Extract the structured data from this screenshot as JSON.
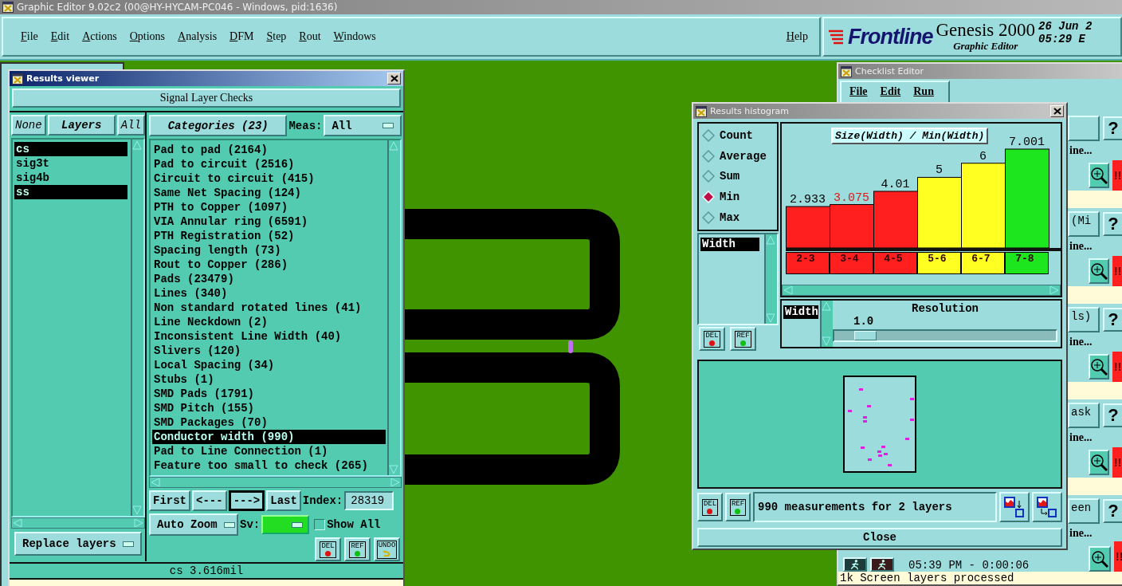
{
  "window": {
    "title": "Graphic Editor 9.02c2 (00@HY-HYCAM-PC046 - Windows, pid:1636)"
  },
  "menu": [
    "File",
    "Edit",
    "Actions",
    "Options",
    "Analysis",
    "DFM",
    "Step",
    "Rout",
    "Windows"
  ],
  "help": "Help",
  "brand": {
    "logo": "Frontline",
    "product": "Genesis 2000",
    "subtitle": "Graphic Editor",
    "date": "26 Jun 2",
    "time": "05:29 E"
  },
  "results_viewer": {
    "title": "Results viewer",
    "header": "Signal Layer Checks",
    "layer_buttons": [
      {
        "label": "None",
        "kind": "select"
      },
      {
        "label": "Layers",
        "kind": "header"
      },
      {
        "label": "All",
        "kind": "select"
      }
    ],
    "layers": [
      {
        "name": "cs",
        "selected": true
      },
      {
        "name": "sig3t",
        "selected": false
      },
      {
        "name": "sig4b",
        "selected": false
      },
      {
        "name": "ss",
        "selected": true
      }
    ],
    "replace": "Replace layers",
    "categories_button": "Categories (23)",
    "meas_label": "Meas:",
    "meas_value": "All",
    "categories": [
      {
        "label": "Pad to pad (2164)",
        "selected": false
      },
      {
        "label": "Pad to circuit (2516)",
        "selected": false
      },
      {
        "label": "Circuit to circuit (415)",
        "selected": false
      },
      {
        "label": "Same Net Spacing (124)",
        "selected": false
      },
      {
        "label": "PTH to Copper (1097)",
        "selected": false
      },
      {
        "label": "VIA Annular ring (6591)",
        "selected": false
      },
      {
        "label": "PTH Registration (52)",
        "selected": false
      },
      {
        "label": "Spacing length (73)",
        "selected": false
      },
      {
        "label": "Rout to Copper (286)",
        "selected": false
      },
      {
        "label": "Pads (23479)",
        "selected": false
      },
      {
        "label": "Lines (340)",
        "selected": false
      },
      {
        "label": "Non standard rotated lines (41)",
        "selected": false
      },
      {
        "label": "Line Neckdown (2)",
        "selected": false
      },
      {
        "label": "Inconsistent Line Width (40)",
        "selected": false
      },
      {
        "label": "Slivers (120)",
        "selected": false
      },
      {
        "label": "Local Spacing (34)",
        "selected": false
      },
      {
        "label": "Stubs (1)",
        "selected": false
      },
      {
        "label": "SMD Pads (1791)",
        "selected": false
      },
      {
        "label": "SMD Pitch (155)",
        "selected": false
      },
      {
        "label": "SMD Packages (70)",
        "selected": false
      },
      {
        "label": "Conductor width (990)",
        "selected": true
      },
      {
        "label": "Pad to Line Connection (1)",
        "selected": false
      },
      {
        "label": "Feature too small to check (265)",
        "selected": false
      }
    ],
    "nav": [
      {
        "label": "First",
        "focused": false
      },
      {
        "label": "<---",
        "focused": false
      },
      {
        "label": "--->",
        "focused": true
      },
      {
        "label": "Last",
        "focused": false
      }
    ],
    "index_label": "Index:",
    "index_value": "28319",
    "auto_zoom": "Auto Zoom",
    "sv_label": "Sv:",
    "show_all": {
      "label": "Show All",
      "checked": false
    },
    "tools": [
      {
        "kind": "del",
        "label": "DEL"
      },
      {
        "kind": "ref",
        "label": "REF"
      },
      {
        "kind": "undo",
        "label": "UNDO"
      }
    ],
    "status": "cs 3.616mil"
  },
  "histogram": {
    "title": "Results histogram",
    "modes": [
      {
        "label": "Count",
        "selected": false
      },
      {
        "label": "Average",
        "selected": false
      },
      {
        "label": "Sum",
        "selected": false
      },
      {
        "label": "Min",
        "selected": true
      },
      {
        "label": "Max",
        "selected": false
      }
    ],
    "fields": [
      {
        "label": "Width",
        "selected": true
      }
    ],
    "tools": [
      {
        "kind": "del",
        "label": "DEL"
      },
      {
        "kind": "ref",
        "label": "REF"
      }
    ],
    "map_tools": [
      {
        "kind": "del",
        "label": "DEL"
      },
      {
        "kind": "ref",
        "label": "REF"
      }
    ],
    "chart_data": {
      "type": "bar",
      "title": "Size(Width) / Min(Width)",
      "categories": [
        "2-3",
        "3-4",
        "4-5",
        "5-6",
        "6-7",
        "7-8"
      ],
      "values": [
        2.933,
        3.075,
        4.01,
        5,
        6,
        7.001
      ],
      "data_labels": true
    },
    "bins": [
      {
        "color": "#ff1f1f",
        "selected": false
      },
      {
        "color": "#ff1f1f",
        "selected": true
      },
      {
        "color": "#ff1f1f",
        "selected": false
      },
      {
        "color": "#ffff22",
        "selected": false
      },
      {
        "color": "#ffff22",
        "selected": false
      },
      {
        "color": "#1ee61e",
        "selected": false
      }
    ],
    "resolution": {
      "field": "Width",
      "label": "Resolution",
      "value": "1.0",
      "level": 0.1
    },
    "summary": "990 measurements for 2 layers",
    "close": "Close"
  },
  "checklist": {
    "title": "Checklist Editor",
    "menu": [
      "File",
      "Edit",
      "Run"
    ],
    "blocks": [
      {
        "note": "ine...",
        "help": "?",
        "alert": "!!"
      },
      {
        "label": "(Mi",
        "note": "ine...",
        "help": "?",
        "alert": "!!"
      },
      {
        "label": "ls)",
        "note": "ine...",
        "help": "?",
        "alert": "!!"
      },
      {
        "label": "ask",
        "note": "ine...",
        "help": "?",
        "alert": "!!"
      },
      {
        "label": "een",
        "note": "ine...",
        "help": "?",
        "alert": "!!"
      }
    ],
    "time": "05:39 PM - 0:00:06",
    "status": "1k Screen layers processed"
  }
}
